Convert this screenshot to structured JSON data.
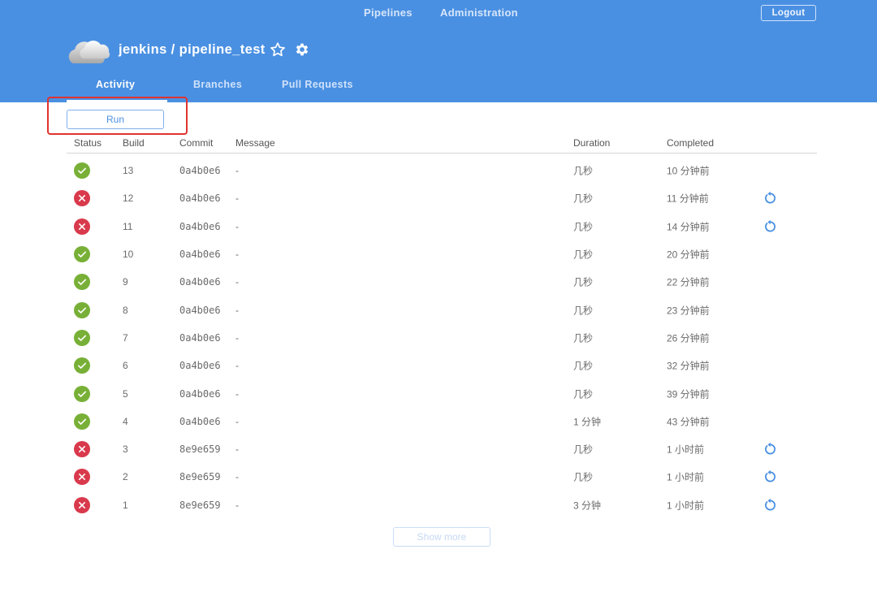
{
  "top_nav": {
    "items": [
      {
        "label": "Pipelines"
      },
      {
        "label": "Administration"
      }
    ],
    "logout_label": "Logout"
  },
  "header": {
    "repo_title": "jenkins / pipeline_test",
    "icons": [
      "cloud-logo",
      "star-icon",
      "gear-icon"
    ]
  },
  "tabs": [
    {
      "label": "Activity",
      "active": true
    },
    {
      "label": "Branches",
      "active": false
    },
    {
      "label": "Pull Requests",
      "active": false
    }
  ],
  "run_button": {
    "label": "Run"
  },
  "table": {
    "columns": {
      "status": "Status",
      "build": "Build",
      "commit": "Commit",
      "message": "Message",
      "duration": "Duration",
      "completed": "Completed"
    },
    "rows": [
      {
        "status": "success",
        "build": "13",
        "commit": "0a4b0e6",
        "message": "-",
        "duration": "几秒",
        "completed": "10 分钟前",
        "rerun": false
      },
      {
        "status": "failure",
        "build": "12",
        "commit": "0a4b0e6",
        "message": "-",
        "duration": "几秒",
        "completed": "11 分钟前",
        "rerun": true
      },
      {
        "status": "failure",
        "build": "11",
        "commit": "0a4b0e6",
        "message": "-",
        "duration": "几秒",
        "completed": "14 分钟前",
        "rerun": true
      },
      {
        "status": "success",
        "build": "10",
        "commit": "0a4b0e6",
        "message": "-",
        "duration": "几秒",
        "completed": "20 分钟前",
        "rerun": false
      },
      {
        "status": "success",
        "build": "9",
        "commit": "0a4b0e6",
        "message": "-",
        "duration": "几秒",
        "completed": "22 分钟前",
        "rerun": false
      },
      {
        "status": "success",
        "build": "8",
        "commit": "0a4b0e6",
        "message": "-",
        "duration": "几秒",
        "completed": "23 分钟前",
        "rerun": false
      },
      {
        "status": "success",
        "build": "7",
        "commit": "0a4b0e6",
        "message": "-",
        "duration": "几秒",
        "completed": "26 分钟前",
        "rerun": false
      },
      {
        "status": "success",
        "build": "6",
        "commit": "0a4b0e6",
        "message": "-",
        "duration": "几秒",
        "completed": "32 分钟前",
        "rerun": false
      },
      {
        "status": "success",
        "build": "5",
        "commit": "0a4b0e6",
        "message": "-",
        "duration": "几秒",
        "completed": "39 分钟前",
        "rerun": false
      },
      {
        "status": "success",
        "build": "4",
        "commit": "0a4b0e6",
        "message": "-",
        "duration": "1 分钟",
        "completed": "43 分钟前",
        "rerun": false
      },
      {
        "status": "failure",
        "build": "3",
        "commit": "8e9e659",
        "message": "-",
        "duration": "几秒",
        "completed": "1 小时前",
        "rerun": true
      },
      {
        "status": "failure",
        "build": "2",
        "commit": "8e9e659",
        "message": "-",
        "duration": "几秒",
        "completed": "1 小时前",
        "rerun": true
      },
      {
        "status": "failure",
        "build": "1",
        "commit": "8e9e659",
        "message": "-",
        "duration": "3 分钟",
        "completed": "1 小时前",
        "rerun": true
      }
    ]
  },
  "show_more": {
    "label": "Show more"
  },
  "colors": {
    "header_bg": "#4a90e2",
    "success": "#78b037",
    "failure": "#d9394c",
    "accent": "#4a90e2",
    "highlight": "#e0332f"
  }
}
